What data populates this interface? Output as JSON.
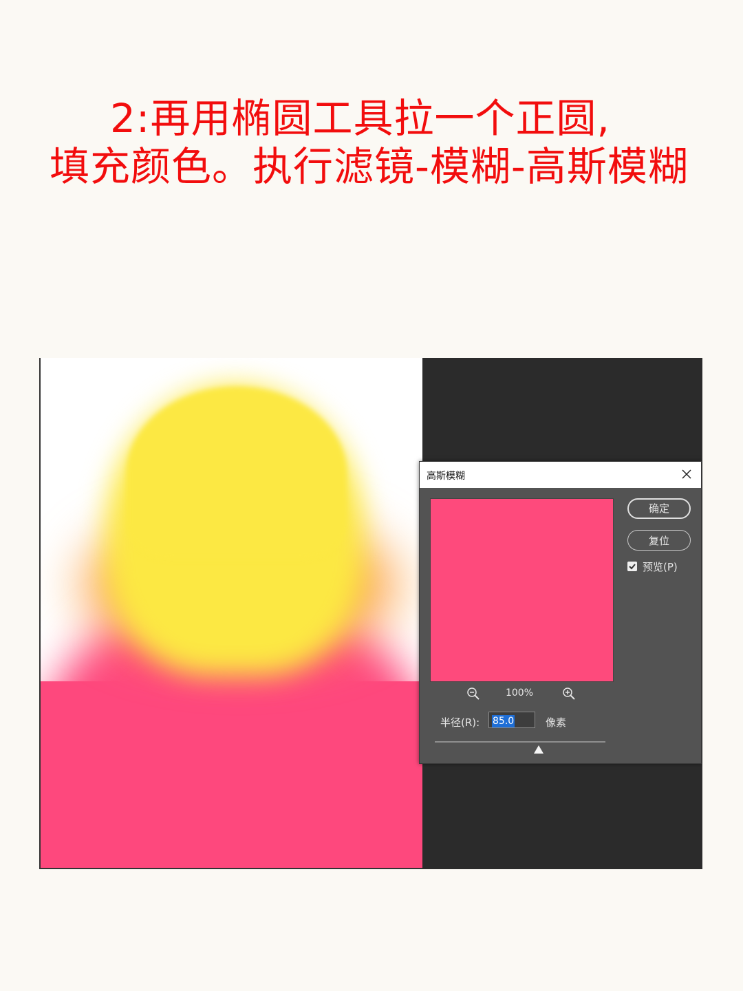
{
  "caption": {
    "line1": "2:再用椭圆工具拉一个正圆,",
    "line2": "填充颜色。执行滤镜-模糊-高斯模糊"
  },
  "canvas": {
    "colors": {
      "yellow": "#fce843",
      "orange": "#fca44a",
      "pink": "#fe487d",
      "background": "#ffffff",
      "workspace": "#2b2b2b"
    }
  },
  "dialog": {
    "title": "高斯模糊",
    "close_icon": "close-icon",
    "ok_label": "确定",
    "reset_label": "复位",
    "preview_label": "预览(P)",
    "preview_checked": true,
    "zoom_level": "100%",
    "zoom_out_icon": "zoom-out-icon",
    "zoom_in_icon": "zoom-in-icon",
    "radius_label": "半径(R):",
    "radius_value": "85.0",
    "unit_label": "像素",
    "preview_color": "#fe4a7c"
  }
}
